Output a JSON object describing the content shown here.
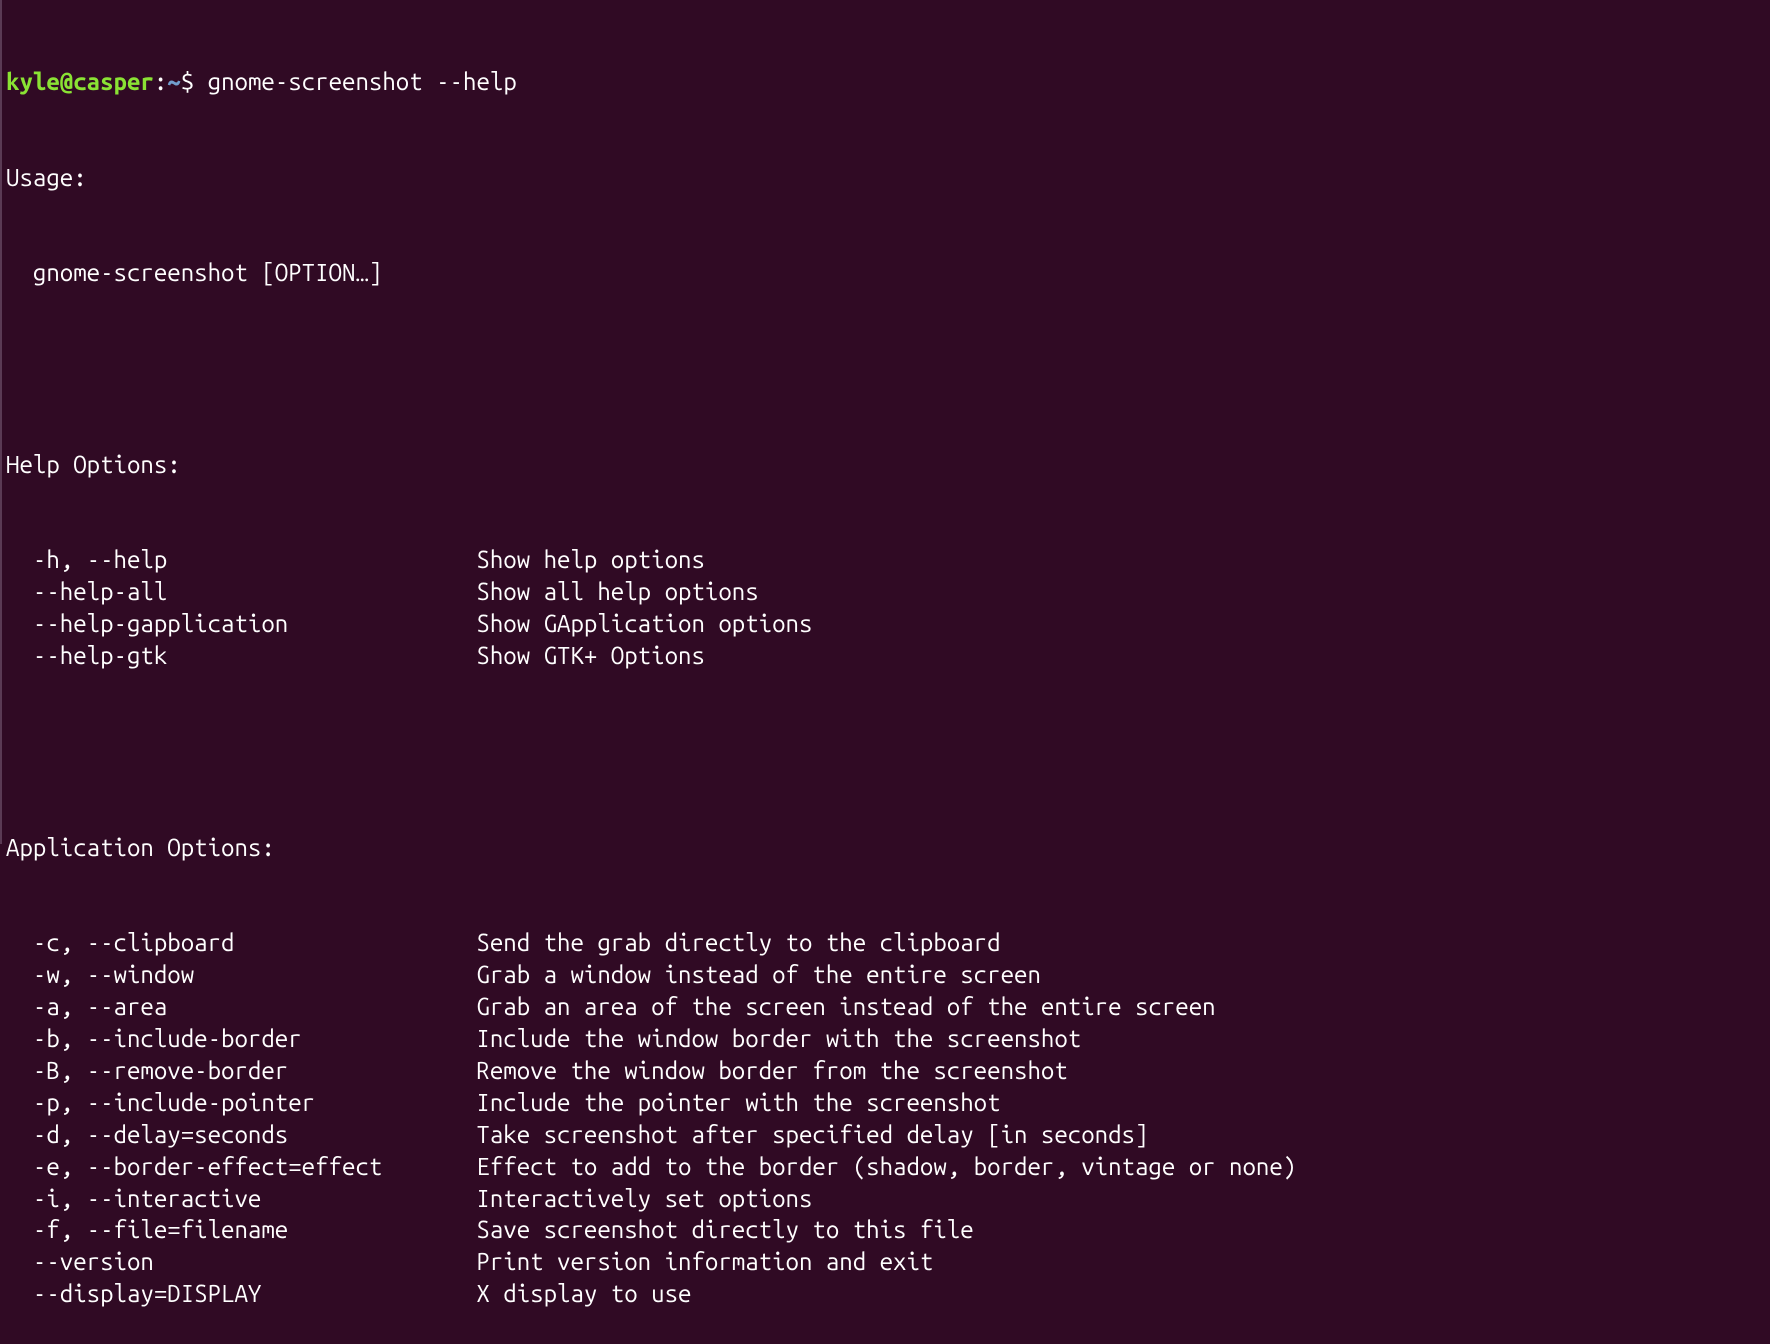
{
  "prompt": {
    "user": "kyle@casper",
    "sep1": ":",
    "path": "~",
    "sep2": "$ ",
    "command": "gnome-screenshot --help"
  },
  "usage": {
    "header": "Usage:",
    "line": "  gnome-screenshot [OPTION…]"
  },
  "help_options": {
    "header": "Help Options:",
    "rows": [
      {
        "flag": "-h, --help",
        "desc": "Show help options"
      },
      {
        "flag": "--help-all",
        "desc": "Show all help options"
      },
      {
        "flag": "--help-gapplication",
        "desc": "Show GApplication options"
      },
      {
        "flag": "--help-gtk",
        "desc": "Show GTK+ Options"
      }
    ]
  },
  "app_options": {
    "header": "Application Options:",
    "rows": [
      {
        "flag": "-c, --clipboard",
        "desc": "Send the grab directly to the clipboard"
      },
      {
        "flag": "-w, --window",
        "desc": "Grab a window instead of the entire screen"
      },
      {
        "flag": "-a, --area",
        "desc": "Grab an area of the screen instead of the entire screen"
      },
      {
        "flag": "-b, --include-border",
        "desc": "Include the window border with the screenshot"
      },
      {
        "flag": "-B, --remove-border",
        "desc": "Remove the window border from the screenshot"
      },
      {
        "flag": "-p, --include-pointer",
        "desc": "Include the pointer with the screenshot"
      },
      {
        "flag": "-d, --delay=seconds",
        "desc": "Take screenshot after specified delay [in seconds]"
      },
      {
        "flag": "-e, --border-effect=effect",
        "desc": "Effect to add to the border (shadow, border, vintage or none)"
      },
      {
        "flag": "-i, --interactive",
        "desc": "Interactively set options"
      },
      {
        "flag": "-f, --file=filename",
        "desc": "Save screenshot directly to this file"
      },
      {
        "flag": "--version",
        "desc": "Print version information and exit"
      },
      {
        "flag": "--display=DISPLAY",
        "desc": "X display to use"
      }
    ]
  }
}
